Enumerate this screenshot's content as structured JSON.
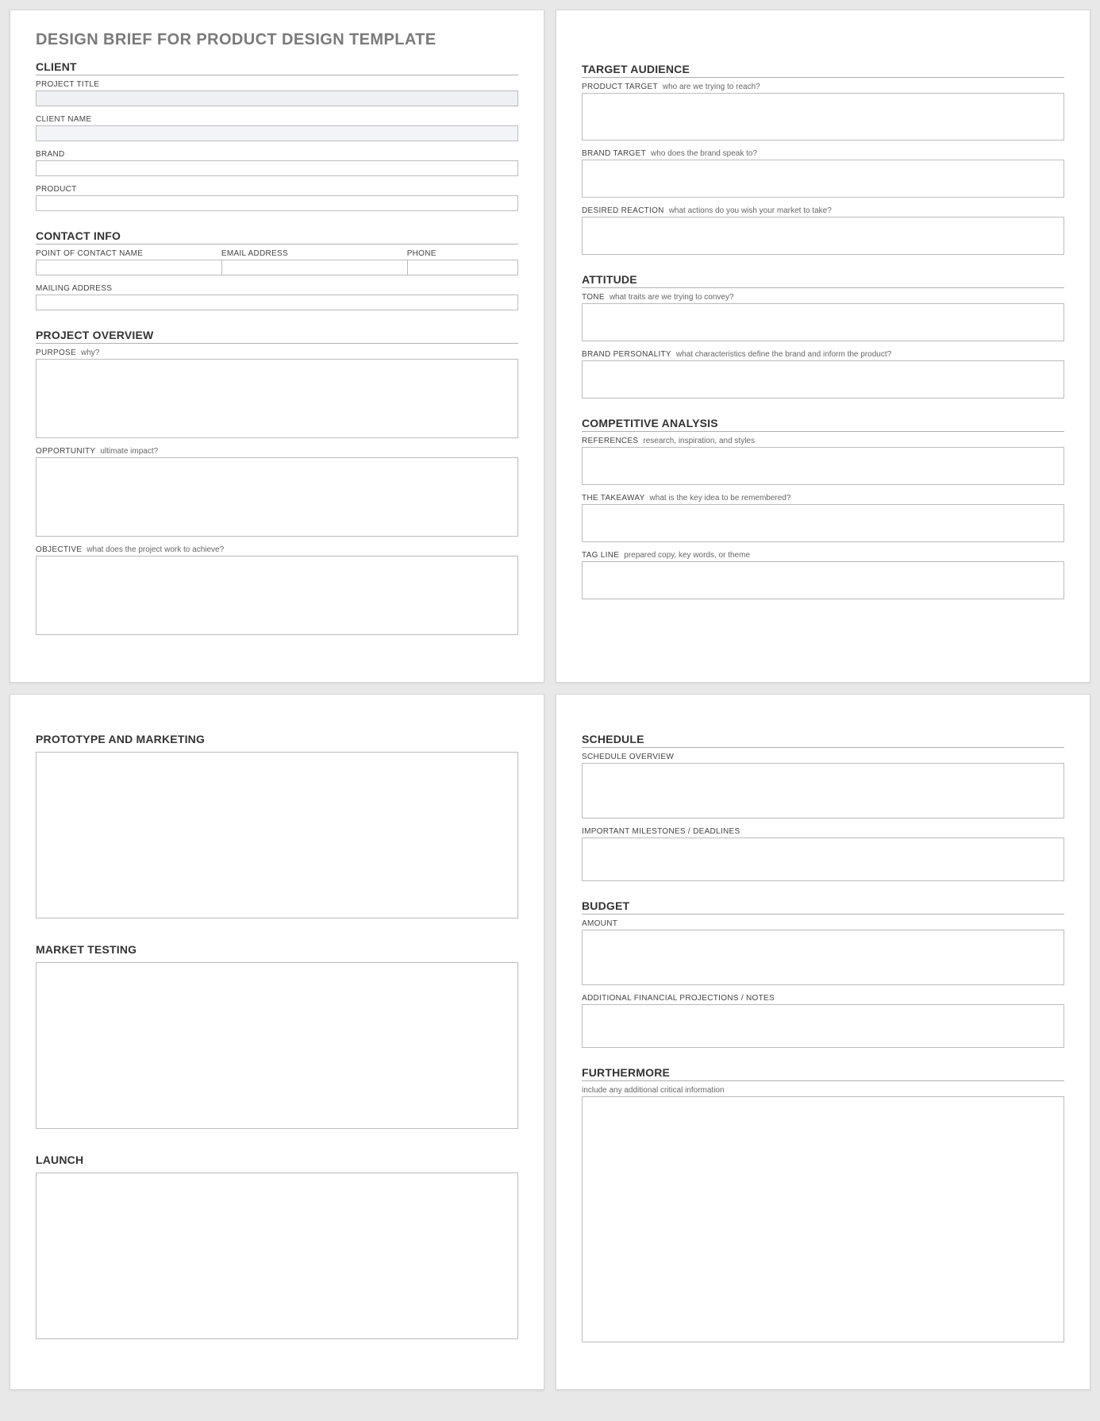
{
  "doc_title": "DESIGN BRIEF FOR PRODUCT DESIGN TEMPLATE",
  "p1": {
    "client_head": "CLIENT",
    "project_title_lbl": "PROJECT TITLE",
    "client_name_lbl": "CLIENT NAME",
    "brand_lbl": "BRAND",
    "product_lbl": "PRODUCT",
    "contact_head": "CONTACT INFO",
    "poc_lbl": "POINT OF CONTACT NAME",
    "email_lbl": "EMAIL ADDRESS",
    "phone_lbl": "PHONE",
    "mailing_lbl": "MAILING ADDRESS",
    "overview_head": "PROJECT OVERVIEW",
    "purpose_lbl": "PURPOSE",
    "purpose_hint": "why?",
    "opportunity_lbl": "OPPORTUNITY",
    "opportunity_hint": "ultimate impact?",
    "objective_lbl": "OBJECTIVE",
    "objective_hint": "what does the project work to achieve?"
  },
  "p2": {
    "target_head": "TARGET AUDIENCE",
    "product_target_lbl": "PRODUCT TARGET",
    "product_target_hint": "who are we trying to reach?",
    "brand_target_lbl": "BRAND TARGET",
    "brand_target_hint": "who does the brand speak to?",
    "desired_lbl": "DESIRED REACTION",
    "desired_hint": "what actions do you wish your market to take?",
    "attitude_head": "ATTITUDE",
    "tone_lbl": "TONE",
    "tone_hint": "what traits are we trying to convey?",
    "personality_lbl": "BRAND PERSONALITY",
    "personality_hint": "what characteristics define the brand and inform the product?",
    "comp_head": "COMPETITIVE ANALYSIS",
    "refs_lbl": "REFERENCES",
    "refs_hint": "research, inspiration, and styles",
    "takeaway_lbl": "THE TAKEAWAY",
    "takeaway_hint": "what is the key idea to be remembered?",
    "tagline_lbl": "TAG LINE",
    "tagline_hint": "prepared copy, key words, or theme"
  },
  "p3": {
    "proto_head": "PROTOTYPE AND MARKETING",
    "market_head": "MARKET TESTING",
    "launch_head": "LAUNCH"
  },
  "p4": {
    "schedule_head": "SCHEDULE",
    "schedule_overview_lbl": "SCHEDULE OVERVIEW",
    "milestones_lbl": "IMPORTANT MILESTONES / DEADLINES",
    "budget_head": "BUDGET",
    "amount_lbl": "AMOUNT",
    "fin_notes_lbl": "ADDITIONAL FINANCIAL PROJECTIONS / NOTES",
    "further_head": "FURTHERMORE",
    "further_hint": "include any additional critical information"
  }
}
